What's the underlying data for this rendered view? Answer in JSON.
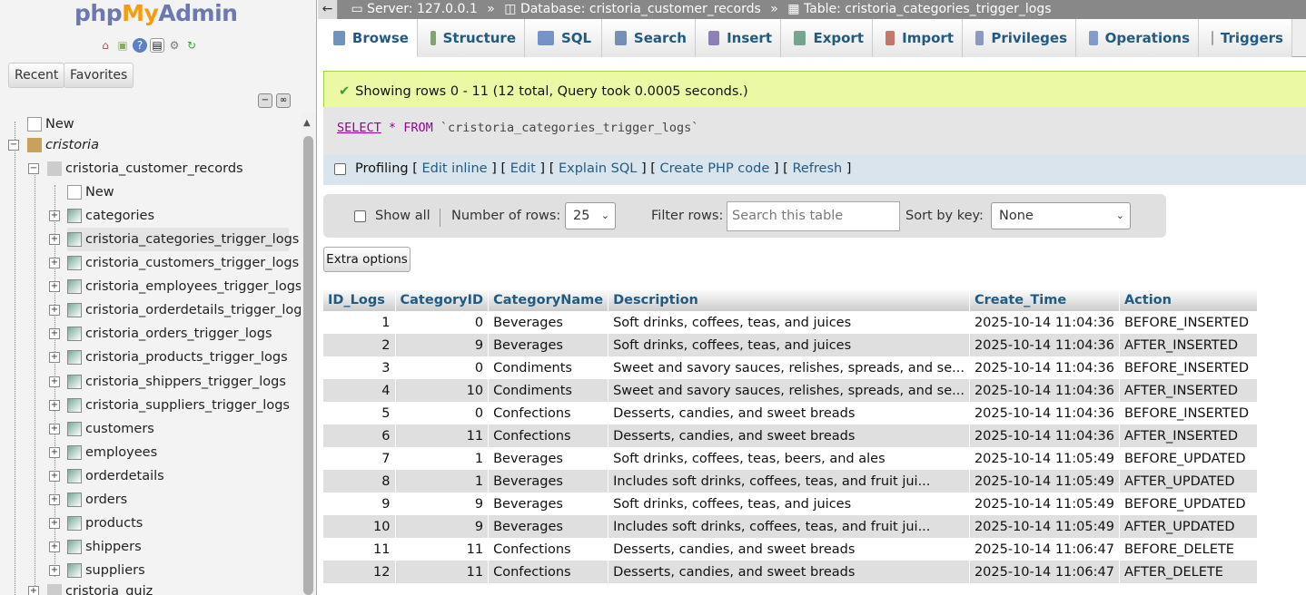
{
  "app": {
    "logo_part1": "php",
    "logo_part2": "My",
    "logo_part3": "Admin"
  },
  "nav": {
    "recent": "Recent",
    "favorites": "Favorites",
    "tree": {
      "new_root": "New",
      "db": "cristoria",
      "subdb": "cristoria_customer_records",
      "new_table": "New",
      "tables": [
        "categories",
        "cristoria_categories_trigger_logs",
        "cristoria_customers_trigger_logs",
        "cristoria_employees_trigger_logs",
        "cristoria_orderdetails_trigger_logs",
        "cristoria_orders_trigger_logs",
        "cristoria_products_trigger_logs",
        "cristoria_shippers_trigger_logs",
        "cristoria_suppliers_trigger_logs",
        "customers",
        "employees",
        "orderdetails",
        "orders",
        "products",
        "shippers",
        "suppliers"
      ],
      "next_db": "cristoria_quiz"
    }
  },
  "breadcrumb": {
    "server": "Server: 127.0.0.1",
    "database": "Database: cristoria_customer_records",
    "table": "Table: cristoria_categories_trigger_logs",
    "sep": "»"
  },
  "tabs": [
    "Browse",
    "Structure",
    "SQL",
    "Search",
    "Insert",
    "Export",
    "Import",
    "Privileges",
    "Operations",
    "Triggers"
  ],
  "message": "Showing rows 0 - 11 (12 total, Query took 0.0005 seconds.)",
  "query": {
    "select": "SELECT",
    "star": "*",
    "from": "FROM",
    "table": "`cristoria_categories_trigger_logs`"
  },
  "profiling": {
    "label": "Profiling",
    "edit_inline": "Edit inline",
    "edit": "Edit",
    "explain": "Explain SQL",
    "php": "Create PHP code",
    "refresh": "Refresh"
  },
  "filter": {
    "show_all": "Show all",
    "num_rows_label": "Number of rows:",
    "num_rows": "25",
    "filter_label": "Filter rows:",
    "search_placeholder": "Search this table",
    "sort_label": "Sort by key:",
    "sort_value": "None"
  },
  "extra_options": "Extra options",
  "table": {
    "headers": [
      "ID_Logs",
      "CategoryID",
      "CategoryName",
      "Description",
      "Create_Time",
      "Action"
    ],
    "rows": [
      [
        "1",
        "0",
        "Beverages",
        "Soft drinks, coffees, teas, and juices",
        "2025-10-14 11:04:36",
        "BEFORE_INSERTED"
      ],
      [
        "2",
        "9",
        "Beverages",
        "Soft drinks, coffees, teas, and juices",
        "2025-10-14 11:04:36",
        "AFTER_INSERTED"
      ],
      [
        "3",
        "0",
        "Condiments",
        "Sweet and savory sauces, relishes, spreads, and se...",
        "2025-10-14 11:04:36",
        "BEFORE_INSERTED"
      ],
      [
        "4",
        "10",
        "Condiments",
        "Sweet and savory sauces, relishes, spreads, and se...",
        "2025-10-14 11:04:36",
        "AFTER_INSERTED"
      ],
      [
        "5",
        "0",
        "Confections",
        "Desserts, candies, and sweet breads",
        "2025-10-14 11:04:36",
        "BEFORE_INSERTED"
      ],
      [
        "6",
        "11",
        "Confections",
        "Desserts, candies, and sweet breads",
        "2025-10-14 11:04:36",
        "AFTER_INSERTED"
      ],
      [
        "7",
        "1",
        "Beverages",
        "Soft drinks, coffees, teas, beers, and ales",
        "2025-10-14 11:05:49",
        "BEFORE_UPDATED"
      ],
      [
        "8",
        "1",
        "Beverages",
        "Includes soft drinks, coffees, teas, and fruit jui...",
        "2025-10-14 11:05:49",
        "AFTER_UPDATED"
      ],
      [
        "9",
        "9",
        "Beverages",
        "Soft drinks, coffees, teas, and juices",
        "2025-10-14 11:05:49",
        "BEFORE_UPDATED"
      ],
      [
        "10",
        "9",
        "Beverages",
        "Includes soft drinks, coffees, teas, and fruit jui...",
        "2025-10-14 11:05:49",
        "AFTER_UPDATED"
      ],
      [
        "11",
        "11",
        "Confections",
        "Desserts, candies, and sweet breads",
        "2025-10-14 11:06:47",
        "BEFORE_DELETE"
      ],
      [
        "12",
        "11",
        "Confections",
        "Desserts, candies, and sweet breads",
        "2025-10-14 11:06:47",
        "AFTER_DELETE"
      ]
    ]
  },
  "colors": {
    "link": "#235a81",
    "success_bg": "#ebf8a4",
    "sql_keyword": "#990099"
  }
}
